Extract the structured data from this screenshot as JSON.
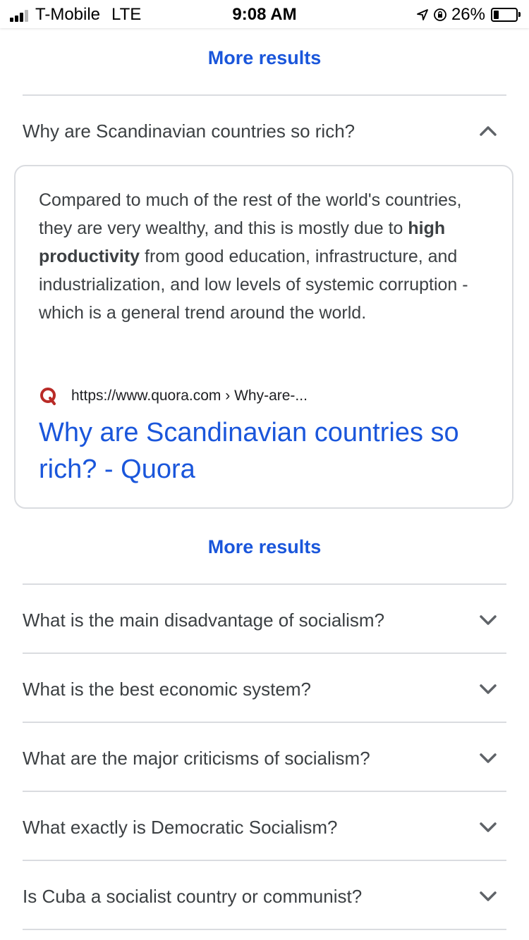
{
  "status_bar": {
    "carrier": "T-Mobile",
    "network": "LTE",
    "time": "9:08 AM",
    "battery": "26%",
    "battery_level": 0.26
  },
  "more_results_label": "More results",
  "expanded_question": {
    "text": "Why are Scandinavian countries so rich?",
    "answer_before": "Compared to much of the rest of the world's countries, they are very wealthy, and this is mostly due to ",
    "answer_bold": "high productivity",
    "answer_after": " from good education, infrastructure, and industrialization, and low levels of systemic corruption - which is a general trend around the world.",
    "source_url": "https://www.quora.com › Why-are-...",
    "result_title": "Why are Scandinavian countries so rich? - Quora"
  },
  "questions": [
    "What is the main disadvantage of socialism?",
    "What is the best economic system?",
    "What are the major criticisms of socialism?",
    "What exactly is Democratic Socialism?",
    "Is Cuba a socialist country or communist?"
  ],
  "colors": {
    "link": "#1a56db",
    "text": "#3c4043",
    "divider": "#dadce0",
    "quora_red": "#b92b27"
  }
}
